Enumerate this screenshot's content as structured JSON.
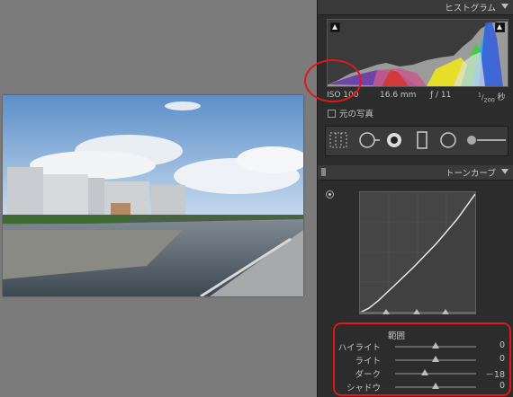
{
  "panels": {
    "histogram": {
      "title": "ヒストグラム"
    },
    "tone_curve": {
      "title": "トーンカーブ"
    }
  },
  "exif": {
    "iso": "ISO 100",
    "focal": "16.6 mm",
    "aperture": "ƒ / 11",
    "shutter_num": "1",
    "shutter_den": "200",
    "shutter_unit": "秒"
  },
  "original_photo_label": "元の写真",
  "range": {
    "label": "範囲",
    "sliders": [
      {
        "label": "ハイライト",
        "value": "0",
        "level": 0
      },
      {
        "label": "ライト",
        "value": "0",
        "level": 0
      },
      {
        "label": "ダーク",
        "value": "－18",
        "level": -18
      },
      {
        "label": "シャドウ",
        "value": "0",
        "level": 0
      }
    ]
  },
  "colors": {
    "annotation": "#e01818",
    "panel": "#2c2c2c",
    "header": "#3a3a3a"
  },
  "icons": [
    "crop-overlay-icon",
    "spot-removal-icon",
    "red-eye-icon",
    "graduated-filter-icon",
    "radial-filter-icon",
    "adjustment-brush-icon",
    "panel-collapse-icon",
    "target-adjust-icon"
  ]
}
